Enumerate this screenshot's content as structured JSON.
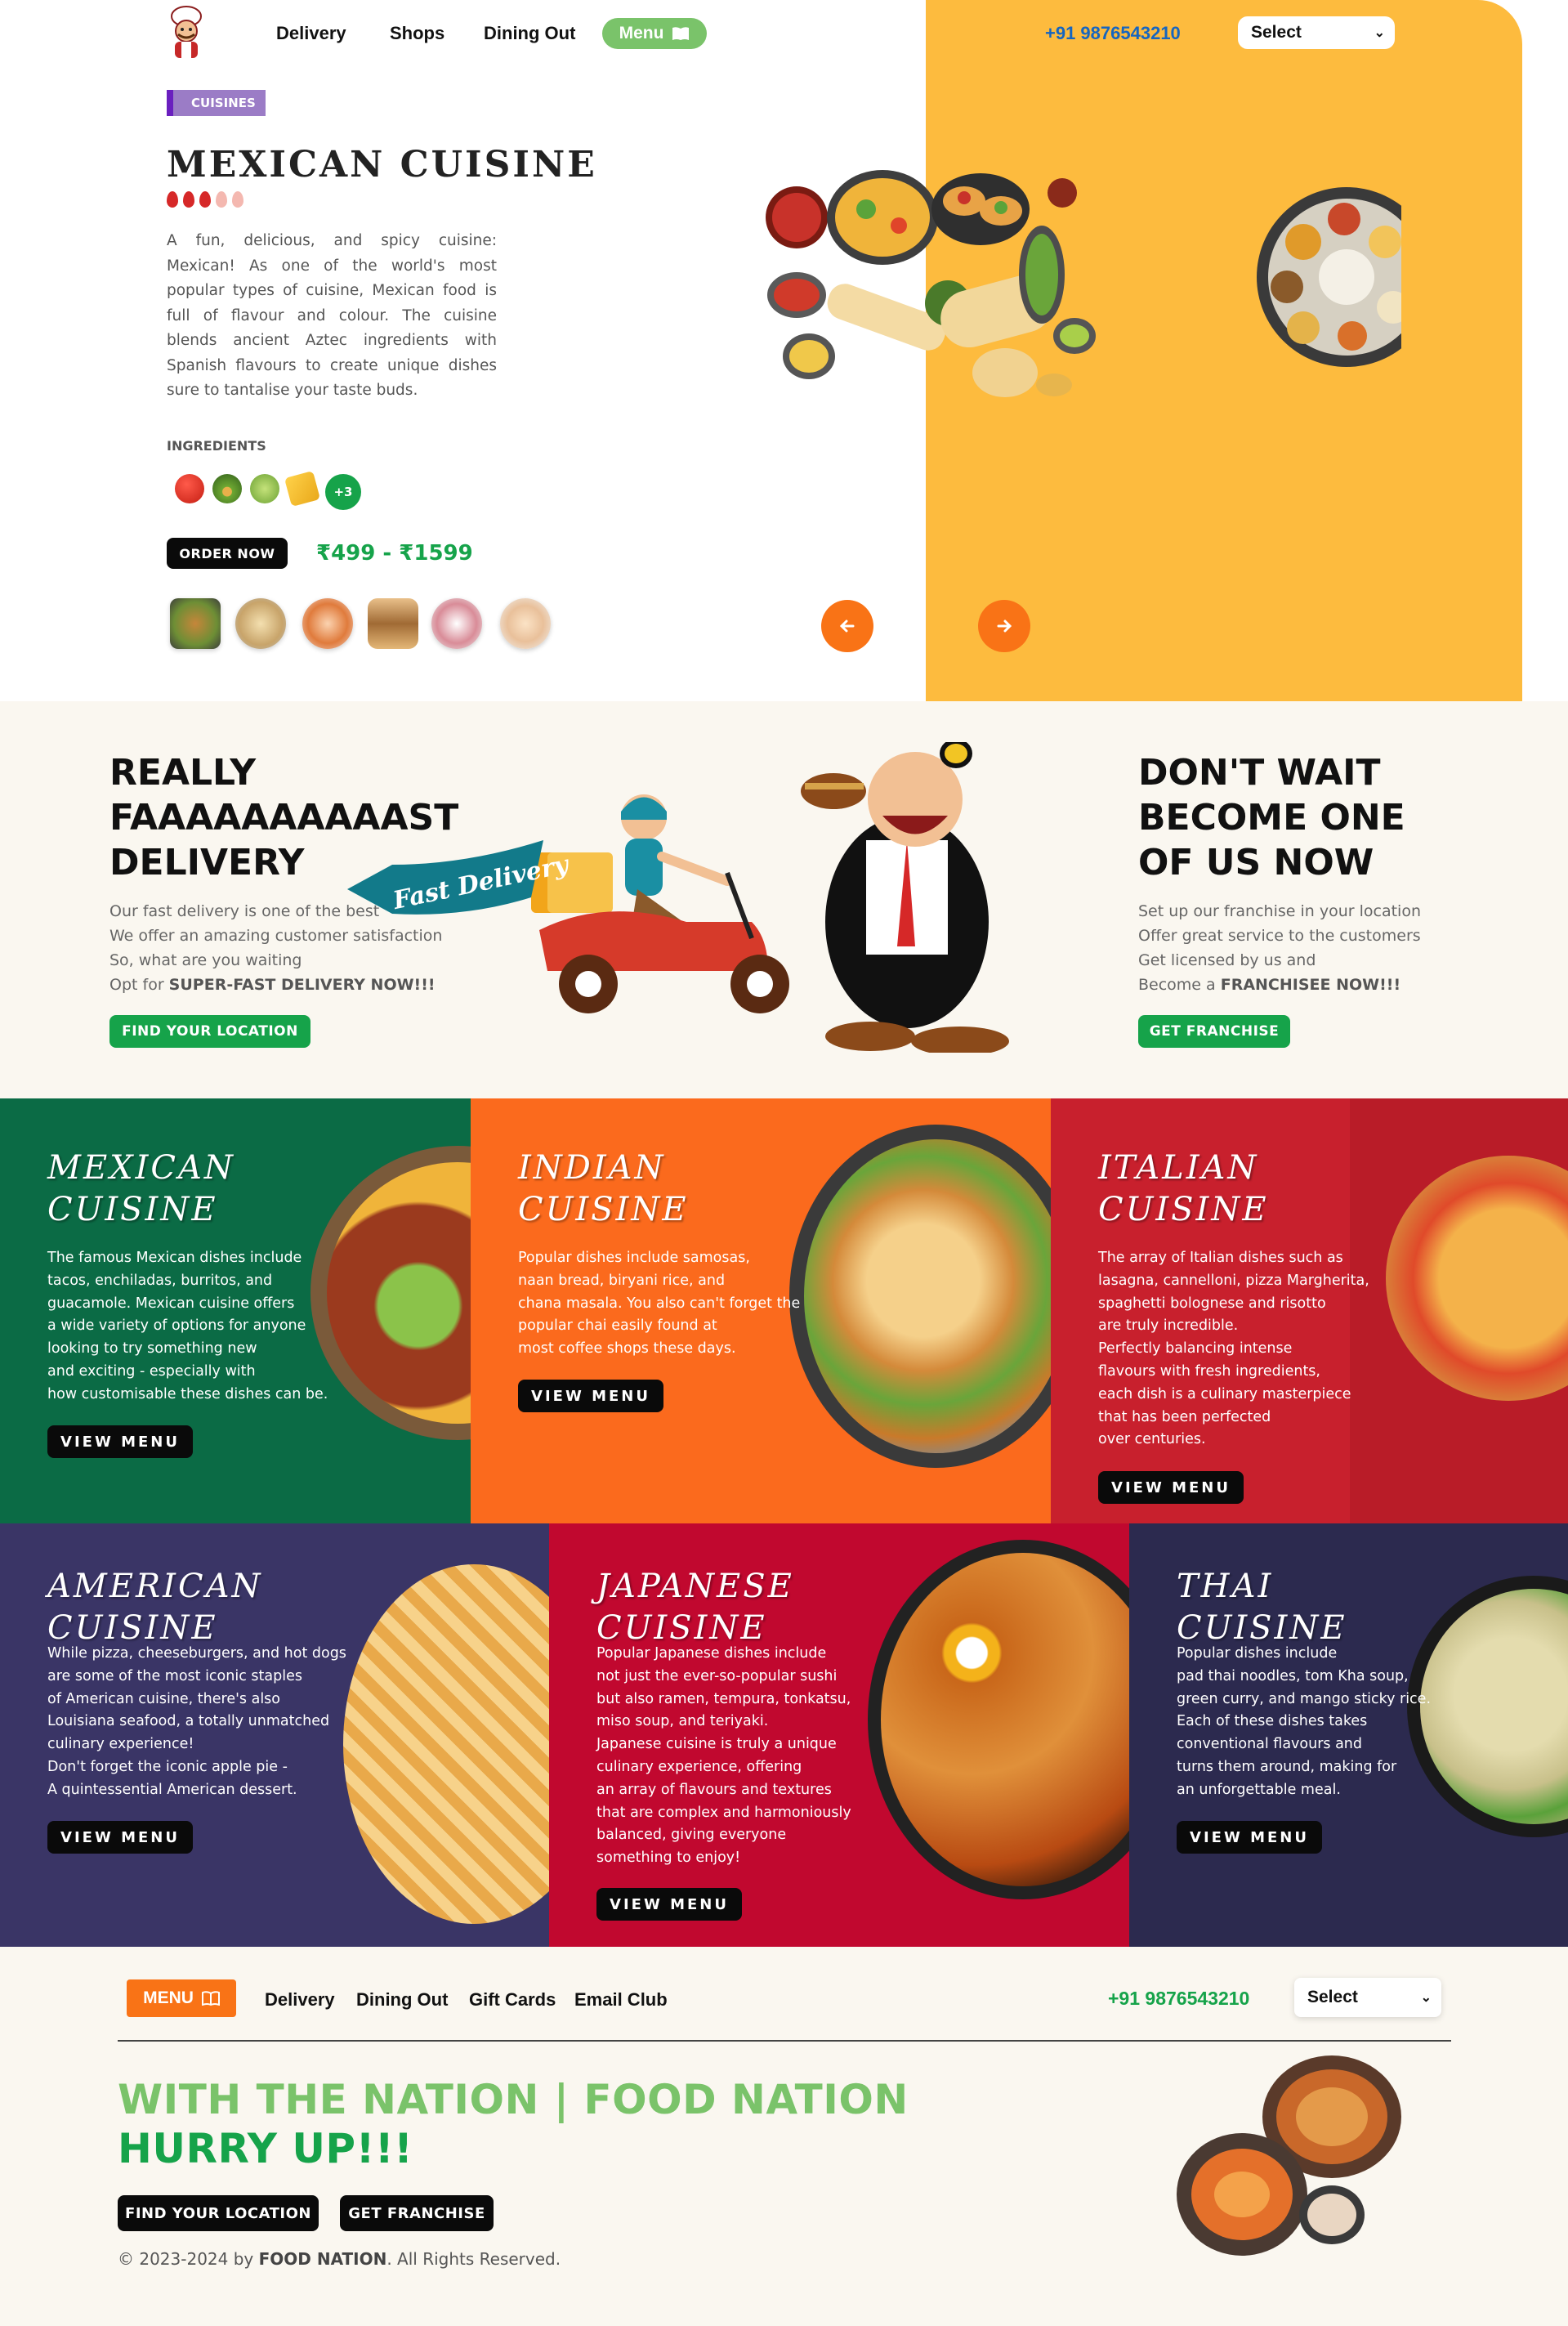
{
  "header": {
    "nav": [
      "Delivery",
      "Shops",
      "Dining Out"
    ],
    "menu_label": "Menu",
    "phone": "+91 9876543210",
    "select_value": "Select"
  },
  "hero": {
    "tag": "CUISINES",
    "title": "MEXICAN CUISINE",
    "spice_level": 3,
    "spice_max": 5,
    "description": "A fun, delicious, and spicy cuisine: Mexican! As one of the world's most popular types of cuisine, Mexican food is full of flavour and colour. The cuisine blends ancient Aztec ingredients with Spanish flavours to create unique dishes sure to tantalise your taste buds.",
    "ingredients_label": "INGREDIENTS",
    "ingredients": [
      "tomato-icon",
      "avocado-icon",
      "lime-icon",
      "cheese-icon"
    ],
    "more_ingredients": "+3",
    "order_label": "ORDER NOW",
    "price": "₹499 - ₹1599",
    "prev_icon": "arrow-left-icon",
    "next_icon": "arrow-right-icon",
    "colors": {
      "accent": "#fdbb3e",
      "brand_green": "#16a34a",
      "arrow": "#f97316"
    }
  },
  "delivery": {
    "heading": [
      "REALLY",
      "FAAAAAAAAAAST",
      "DELIVERY"
    ],
    "lines": [
      "Our fast delivery is one of the best",
      "We offer an amazing customer satisfaction",
      "So, what are you waiting"
    ],
    "cta_prefix": "Opt for ",
    "cta_bold": "SUPER-FAST DELIVERY NOW!!!",
    "button": "FIND YOUR LOCATION",
    "banner": "Fast Delivery"
  },
  "franchise": {
    "heading": [
      "DON'T WAIT",
      "BECOME ONE",
      "OF US NOW"
    ],
    "lines": [
      "Set up our franchise in your location",
      "Offer great service to the customers",
      "Get licensed by us and"
    ],
    "cta_prefix": "Become a ",
    "cta_bold": "FRANCHISEE NOW!!!",
    "button": "GET FRANCHISE"
  },
  "cuisines": [
    {
      "title1": "MEXICAN",
      "title2": "CUISINE",
      "color": "#0b6b45",
      "button": "VIEW MENU",
      "desc": "The famous Mexican dishes include\ntacos, enchiladas, burritos, and\nguacamole. Mexican cuisine offers\na wide variety of options for anyone\nlooking to try something new\nand exciting - especially with\nhow customisable these dishes can be."
    },
    {
      "title1": "INDIAN",
      "title2": "CUISINE",
      "color": "#fb6a1d",
      "button": "VIEW MENU",
      "desc": "Popular dishes include samosas,\nnaan bread, biryani rice, and\nchana masala. You also can't forget the\npopular chai easily found at\nmost coffee shops these days."
    },
    {
      "title1": "ITALIAN",
      "title2": "CUISINE",
      "color": "#c8202d",
      "button": "VIEW MENU",
      "desc": "The array of Italian dishes such as\nlasagna, cannelloni, pizza Margherita,\nspaghetti bolognese and risotto\nare truly incredible.\nPerfectly balancing intense\nflavours with fresh ingredients,\neach dish is a culinary masterpiece\nthat has been perfected\nover centuries."
    },
    {
      "title1": "AMERICAN",
      "title2": "CUISINE",
      "color": "#3a3566",
      "button": "VIEW MENU",
      "desc": "While pizza, cheeseburgers, and hot dogs\nare some of the most iconic staples\nof American cuisine, there's also\nLouisiana seafood, a totally unmatched\nculinary experience!\nDon't forget the iconic apple pie -\nA quintessential American dessert."
    },
    {
      "title1": "JAPANESE",
      "title2": "CUISINE",
      "color": "#c1082f",
      "button": "VIEW MENU",
      "desc": "Popular Japanese dishes include\nnot just the ever-so-popular sushi\nbut also ramen, tempura, tonkatsu,\nmiso soup, and teriyaki.\nJapanese cuisine is truly a unique\nculinary experience, offering\nan array of flavours and textures\nthat are complex and harmoniously\nbalanced, giving everyone\nsomething to enjoy!"
    },
    {
      "title1": "THAI",
      "title2": "CUISINE",
      "color": "#2c2a4f",
      "button": "VIEW MENU",
      "desc": "Popular dishes include\npad thai noodles, tom Kha soup,\ngreen curry, and mango sticky rice.\nEach of these dishes takes\nconventional flavours and\nturns them around, making for\nan unforgettable meal."
    }
  ],
  "footer": {
    "menu_label": "MENU",
    "nav": [
      "Delivery",
      "Dining Out",
      "Gift Cards",
      "Email Club"
    ],
    "phone": "+91 9876543210",
    "select_value": "Select",
    "slogan1": "WITH THE NATION | FOOD NATION",
    "slogan2": "HURRY UP!!!",
    "btn_location": "FIND YOUR LOCATION",
    "btn_franchise": "GET FRANCHISE",
    "copy_prefix": "© 2023-2024 by ",
    "copy_brand": "FOOD NATION",
    "copy_suffix": ". All Rights Reserved."
  }
}
